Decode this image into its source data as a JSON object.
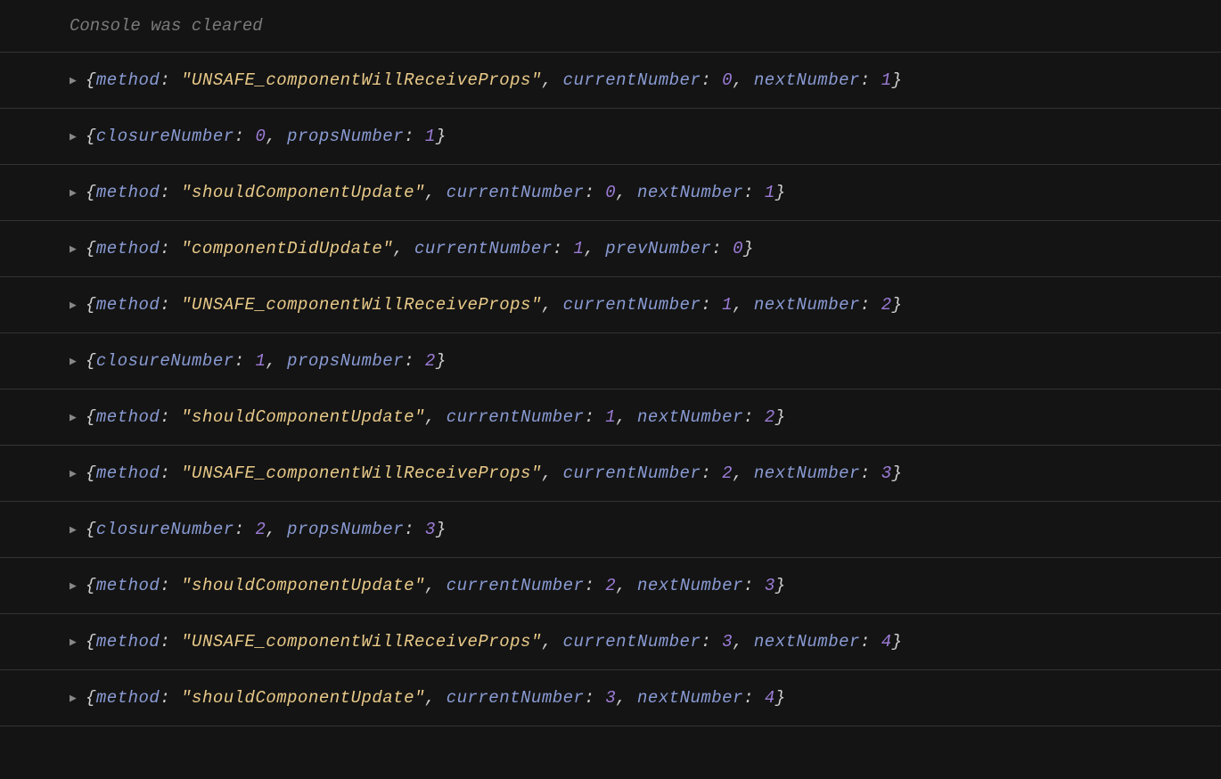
{
  "clearedMessage": "Console was cleared",
  "entries": [
    {
      "type": "method",
      "method": "UNSAFE_componentWillReceiveProps",
      "key2": "currentNumber",
      "val2": 0,
      "key3": "nextNumber",
      "val3": 1
    },
    {
      "type": "closure",
      "closureNumber": 0,
      "propsNumber": 1
    },
    {
      "type": "method",
      "method": "shouldComponentUpdate",
      "key2": "currentNumber",
      "val2": 0,
      "key3": "nextNumber",
      "val3": 1
    },
    {
      "type": "method",
      "method": "componentDidUpdate",
      "key2": "currentNumber",
      "val2": 1,
      "key3": "prevNumber",
      "val3": 0
    },
    {
      "type": "method",
      "method": "UNSAFE_componentWillReceiveProps",
      "key2": "currentNumber",
      "val2": 1,
      "key3": "nextNumber",
      "val3": 2
    },
    {
      "type": "closure",
      "closureNumber": 1,
      "propsNumber": 2
    },
    {
      "type": "method",
      "method": "shouldComponentUpdate",
      "key2": "currentNumber",
      "val2": 1,
      "key3": "nextNumber",
      "val3": 2
    },
    {
      "type": "method",
      "method": "UNSAFE_componentWillReceiveProps",
      "key2": "currentNumber",
      "val2": 2,
      "key3": "nextNumber",
      "val3": 3
    },
    {
      "type": "closure",
      "closureNumber": 2,
      "propsNumber": 3
    },
    {
      "type": "method",
      "method": "shouldComponentUpdate",
      "key2": "currentNumber",
      "val2": 2,
      "key3": "nextNumber",
      "val3": 3
    },
    {
      "type": "method",
      "method": "UNSAFE_componentWillReceiveProps",
      "key2": "currentNumber",
      "val2": 3,
      "key3": "nextNumber",
      "val3": 4
    },
    {
      "type": "method",
      "method": "shouldComponentUpdate",
      "key2": "currentNumber",
      "val2": 3,
      "key3": "nextNumber",
      "val3": 4
    }
  ]
}
